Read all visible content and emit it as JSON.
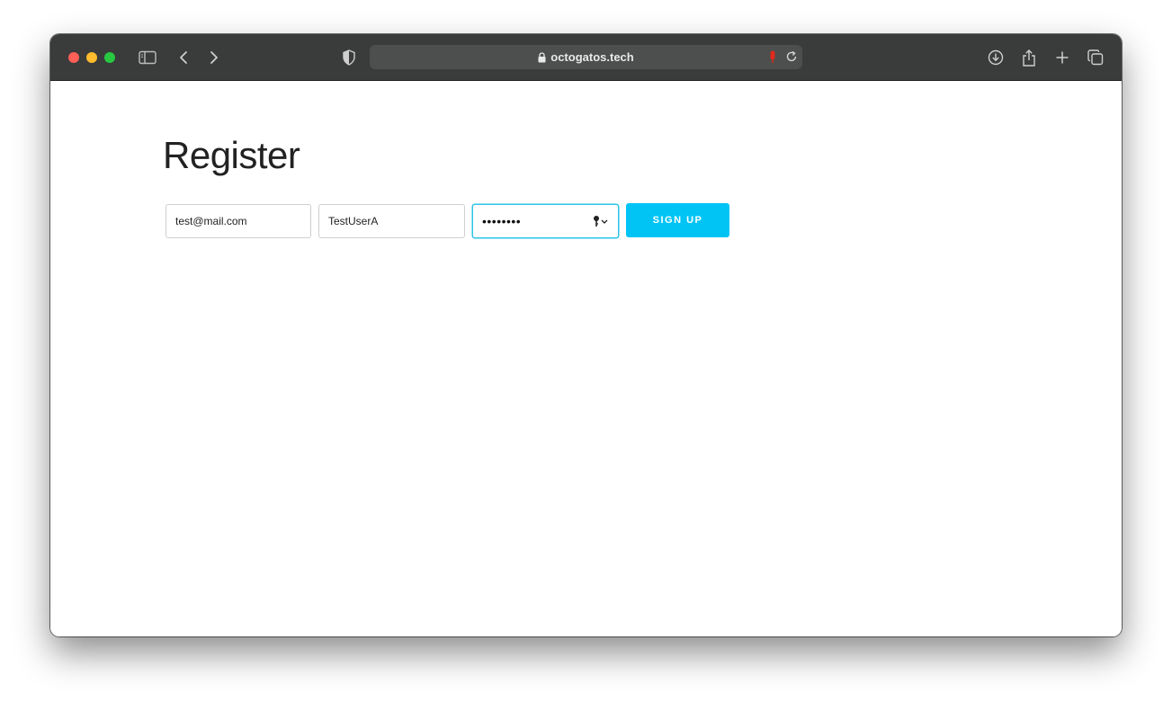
{
  "browser": {
    "url": "octogatos.tech",
    "colors": {
      "toolbar": "#3a3b3b",
      "address_bar": "#4d4e4e"
    },
    "icons": [
      "close-dot",
      "minimize-dot",
      "maximize-dot",
      "sidebar-icon",
      "back-icon",
      "forward-icon",
      "shield-icon",
      "lock-icon",
      "mic-icon",
      "reload-icon",
      "download-icon",
      "share-icon",
      "new-tab-icon",
      "tabs-overview-icon"
    ]
  },
  "page": {
    "title": "Register",
    "form": {
      "email_value": "test@mail.com",
      "username_value": "TestUserA",
      "password_mask": "••••••••",
      "submit_label": "SIGN UP",
      "accent_color": "#01c4f5"
    }
  }
}
